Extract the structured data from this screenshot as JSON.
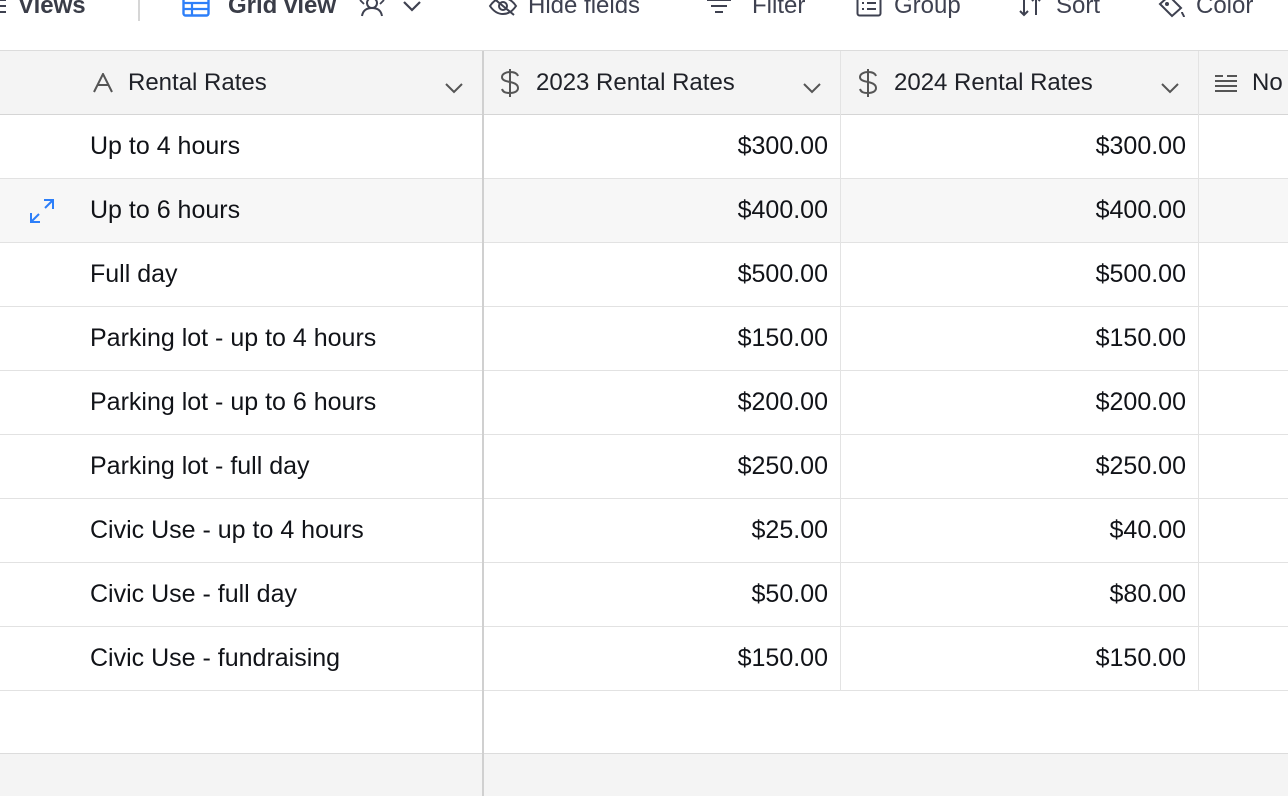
{
  "toolbar": {
    "views_label": "Views",
    "grid_view_label": "Grid view",
    "hide_fields_label": "Hide fields",
    "filter_label": "Filter",
    "group_label": "Group",
    "sort_label": "Sort",
    "color_label": "Color",
    "accent_color": "#2d7ff9"
  },
  "columns": [
    {
      "label": "Rental Rates",
      "icon": "text-field-icon"
    },
    {
      "label": "2023 Rental Rates",
      "icon": "currency-icon"
    },
    {
      "label": "2024 Rental Rates",
      "icon": "currency-icon"
    },
    {
      "label": "No",
      "icon": "long-text-icon"
    }
  ],
  "rows": [
    {
      "name": "Up to 4 hours",
      "r2023": "$300.00",
      "r2024": "$300.00"
    },
    {
      "name": "Up to 6 hours",
      "r2023": "$400.00",
      "r2024": "$400.00"
    },
    {
      "name": "Full day",
      "r2023": "$500.00",
      "r2024": "$500.00"
    },
    {
      "name": "Parking lot - up to 4 hours",
      "r2023": "$150.00",
      "r2024": "$150.00"
    },
    {
      "name": "Parking lot - up to 6 hours",
      "r2023": "$200.00",
      "r2024": "$200.00"
    },
    {
      "name": "Parking lot - full day",
      "r2023": "$250.00",
      "r2024": "$250.00"
    },
    {
      "name": "Civic Use - up to 4 hours",
      "r2023": "$25.00",
      "r2024": "$40.00"
    },
    {
      "name": "Civic Use - full day",
      "r2023": "$50.00",
      "r2024": "$80.00"
    },
    {
      "name": "Civic Use - fundraising",
      "r2023": "$150.00",
      "r2024": "$150.00"
    }
  ]
}
